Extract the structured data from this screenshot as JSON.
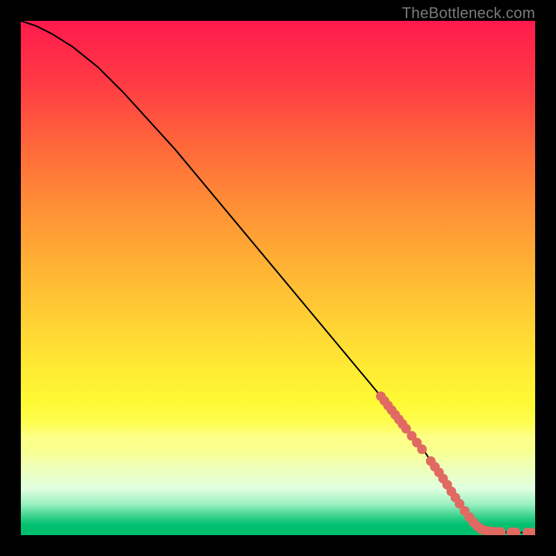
{
  "watermark": "TheBottleneck.com",
  "chart_data": {
    "type": "line",
    "title": "",
    "xlabel": "",
    "ylabel": "",
    "xlim": [
      0,
      100
    ],
    "ylim": [
      0,
      100
    ],
    "grid": false,
    "series": [
      {
        "name": "curve",
        "x": [
          0,
          3,
          6,
          10,
          15,
          20,
          30,
          40,
          50,
          60,
          70,
          78,
          82,
          86,
          90,
          94,
          97,
          100
        ],
        "y": [
          100,
          99,
          97.5,
          95,
          91,
          86,
          75,
          63,
          51,
          39,
          27,
          17,
          11,
          5.5,
          1.2,
          0.6,
          0.5,
          0.5
        ]
      }
    ],
    "markers": [
      {
        "name": "dots",
        "color": "#e06a62",
        "points": [
          {
            "x": 70.0,
            "y": 27.0
          },
          {
            "x": 70.7,
            "y": 26.1
          },
          {
            "x": 71.4,
            "y": 25.2
          },
          {
            "x": 72.1,
            "y": 24.3
          },
          {
            "x": 72.8,
            "y": 23.4
          },
          {
            "x": 73.5,
            "y": 22.5
          },
          {
            "x": 74.2,
            "y": 21.6
          },
          {
            "x": 74.9,
            "y": 20.7
          },
          {
            "x": 76.0,
            "y": 19.3
          },
          {
            "x": 77.0,
            "y": 18.0
          },
          {
            "x": 78.0,
            "y": 16.7
          },
          {
            "x": 79.7,
            "y": 14.4
          },
          {
            "x": 80.5,
            "y": 13.3
          },
          {
            "x": 81.3,
            "y": 12.2
          },
          {
            "x": 82.1,
            "y": 11.0
          },
          {
            "x": 82.9,
            "y": 9.8
          },
          {
            "x": 83.7,
            "y": 8.5
          },
          {
            "x": 84.5,
            "y": 7.3
          },
          {
            "x": 85.3,
            "y": 6.1
          },
          {
            "x": 86.3,
            "y": 4.7
          },
          {
            "x": 87.2,
            "y": 3.5
          },
          {
            "x": 88.0,
            "y": 2.5
          },
          {
            "x": 88.7,
            "y": 1.8
          },
          {
            "x": 89.3,
            "y": 1.3
          },
          {
            "x": 90.0,
            "y": 1.0
          },
          {
            "x": 90.8,
            "y": 0.8
          },
          {
            "x": 91.6,
            "y": 0.7
          },
          {
            "x": 92.4,
            "y": 0.65
          },
          {
            "x": 93.3,
            "y": 0.6
          },
          {
            "x": 95.4,
            "y": 0.55
          },
          {
            "x": 96.2,
            "y": 0.55
          },
          {
            "x": 98.5,
            "y": 0.5
          },
          {
            "x": 99.3,
            "y": 0.5
          }
        ]
      }
    ]
  }
}
